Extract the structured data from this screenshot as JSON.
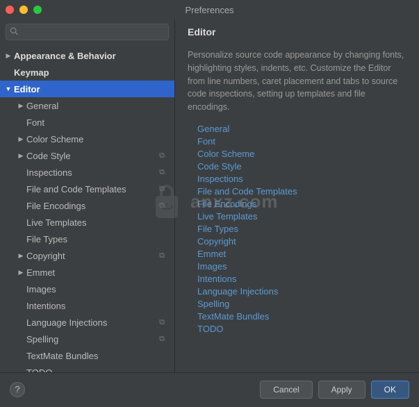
{
  "window": {
    "title": "Preferences"
  },
  "search": {
    "placeholder": ""
  },
  "tree": [
    {
      "label": "Appearance & Behavior",
      "depth": 0,
      "arrow": "right",
      "bold": true,
      "selected": false,
      "badge": false
    },
    {
      "label": "Keymap",
      "depth": 0,
      "arrow": "",
      "bold": true,
      "selected": false,
      "badge": false
    },
    {
      "label": "Editor",
      "depth": 0,
      "arrow": "down",
      "bold": true,
      "selected": true,
      "badge": false
    },
    {
      "label": "General",
      "depth": 1,
      "arrow": "right",
      "bold": false,
      "selected": false,
      "badge": false
    },
    {
      "label": "Font",
      "depth": 1,
      "arrow": "",
      "bold": false,
      "selected": false,
      "badge": false
    },
    {
      "label": "Color Scheme",
      "depth": 1,
      "arrow": "right",
      "bold": false,
      "selected": false,
      "badge": false
    },
    {
      "label": "Code Style",
      "depth": 1,
      "arrow": "right",
      "bold": false,
      "selected": false,
      "badge": true
    },
    {
      "label": "Inspections",
      "depth": 1,
      "arrow": "",
      "bold": false,
      "selected": false,
      "badge": true
    },
    {
      "label": "File and Code Templates",
      "depth": 1,
      "arrow": "",
      "bold": false,
      "selected": false,
      "badge": true
    },
    {
      "label": "File Encodings",
      "depth": 1,
      "arrow": "",
      "bold": false,
      "selected": false,
      "badge": true
    },
    {
      "label": "Live Templates",
      "depth": 1,
      "arrow": "",
      "bold": false,
      "selected": false,
      "badge": false
    },
    {
      "label": "File Types",
      "depth": 1,
      "arrow": "",
      "bold": false,
      "selected": false,
      "badge": false
    },
    {
      "label": "Copyright",
      "depth": 1,
      "arrow": "right",
      "bold": false,
      "selected": false,
      "badge": true
    },
    {
      "label": "Emmet",
      "depth": 1,
      "arrow": "right",
      "bold": false,
      "selected": false,
      "badge": false
    },
    {
      "label": "Images",
      "depth": 1,
      "arrow": "",
      "bold": false,
      "selected": false,
      "badge": false
    },
    {
      "label": "Intentions",
      "depth": 1,
      "arrow": "",
      "bold": false,
      "selected": false,
      "badge": false
    },
    {
      "label": "Language Injections",
      "depth": 1,
      "arrow": "",
      "bold": false,
      "selected": false,
      "badge": true
    },
    {
      "label": "Spelling",
      "depth": 1,
      "arrow": "",
      "bold": false,
      "selected": false,
      "badge": true
    },
    {
      "label": "TextMate Bundles",
      "depth": 1,
      "arrow": "",
      "bold": false,
      "selected": false,
      "badge": false
    },
    {
      "label": "TODO",
      "depth": 1,
      "arrow": "",
      "bold": false,
      "selected": false,
      "badge": false
    }
  ],
  "main": {
    "heading": "Editor",
    "description": "Personalize source code appearance by changing fonts, highlighting styles, indents, etc. Customize the Editor from line numbers, caret placement and tabs to source code inspections, setting up templates and file encodings.",
    "links": [
      "General",
      "Font",
      "Color Scheme",
      "Code Style",
      "Inspections",
      "File and Code Templates",
      "File Encodings",
      "Live Templates",
      "File Types",
      "Copyright",
      "Emmet",
      "Images",
      "Intentions",
      "Language Injections",
      "Spelling",
      "TextMate Bundles",
      "TODO"
    ]
  },
  "footer": {
    "help": "?",
    "cancel": "Cancel",
    "apply": "Apply",
    "ok": "OK"
  },
  "watermark": {
    "text": "anxz.com"
  }
}
